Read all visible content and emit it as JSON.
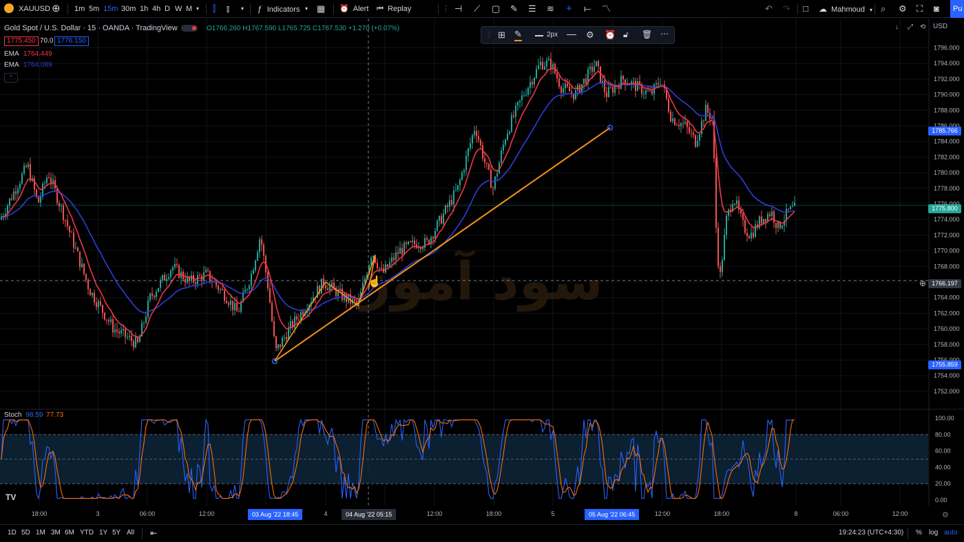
{
  "toolbar": {
    "symbol": "XAUUSD",
    "intervals": [
      "1m",
      "5m",
      "15m",
      "30m",
      "1h",
      "4h",
      "D",
      "W",
      "M"
    ],
    "active_interval": "15m",
    "indicators_label": "Indicators",
    "alert_label": "Alert",
    "replay_label": "Replay",
    "user": "Mahmoud",
    "publish_label": "Pu"
  },
  "legend": {
    "title": "Gold Spot / U.S. Dollar · 15 · OANDA · TradingView",
    "ohlc": "O1766.260 H1767.590 L1765.725 C1767.530 +1.270 (+0.07%)",
    "bid": "1775.450",
    "spread": "70.0",
    "ask": "1776.150",
    "ema1_label": "EMA",
    "ema1_value": "1764.449",
    "ema2_label": "EMA",
    "ema2_value": "1764.089"
  },
  "drawing_toolbar": {
    "width_label": "2px"
  },
  "price_axis": {
    "currency": "USD",
    "ticks": [
      "1796.000",
      "1794.000",
      "1792.000",
      "1790.000",
      "1788.000",
      "1786.000",
      "1784.000",
      "1782.000",
      "1780.000",
      "1778.000",
      "1776.000",
      "1774.000",
      "1772.000",
      "1770.000",
      "1768.000",
      "1766.000",
      "1764.000",
      "1762.000",
      "1760.000",
      "1758.000",
      "1756.000",
      "1754.000",
      "1752.000"
    ],
    "tags": [
      {
        "value": "1785.766",
        "color": "#2962ff"
      },
      {
        "value": "1775.800",
        "color": "#26a69a"
      },
      {
        "value": "1766.197",
        "color": "#363a45"
      },
      {
        "value": "1755.859",
        "color": "#2962ff"
      }
    ]
  },
  "stoch": {
    "label": "Stoch",
    "k": "98.59",
    "d": "77.73",
    "ticks": [
      "100.00",
      "80.00",
      "60.00",
      "40.00",
      "20.00",
      "0.00"
    ]
  },
  "time_axis": {
    "labels": [
      "18:00",
      "3",
      "06:00",
      "12:00",
      "4",
      "12:00",
      "18:00",
      "5",
      "12:00",
      "18:00",
      "8",
      "06:00",
      "12:00"
    ],
    "highlights": [
      "03 Aug '22   18:45",
      "04 Aug '22   05:15",
      "05 Aug '22   06:45"
    ]
  },
  "bottom": {
    "ranges": [
      "1D",
      "5D",
      "1M",
      "3M",
      "6M",
      "YTD",
      "1Y",
      "5Y",
      "All"
    ],
    "clock": "19:24:23 (UTC+4:30)",
    "pct": "%",
    "log": "log",
    "auto": "auto"
  },
  "watermark": "سود آموز",
  "colors": {
    "up": "#26a69a",
    "down": "#ef5350",
    "ema_fast": "#f23645",
    "ema_slow": "#2f3ddb",
    "trend": "#f7931a",
    "stoch_k": "#2962ff",
    "stoch_d": "#ff6d00",
    "accent": "#2962ff"
  }
}
